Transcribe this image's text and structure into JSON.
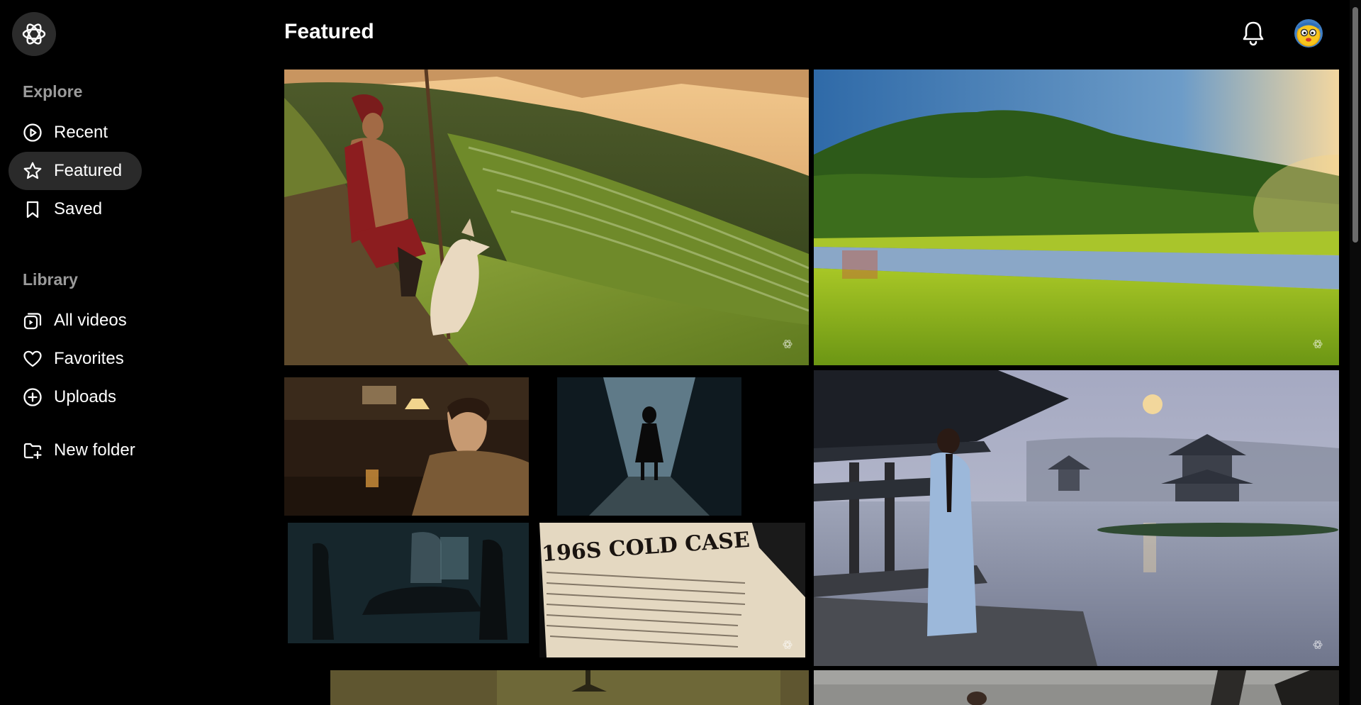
{
  "sidebar": {
    "logo_icon": "openai-logo-icon",
    "explore_title": "Explore",
    "explore_items": [
      {
        "label": "Recent",
        "icon": "play-circle-icon"
      },
      {
        "label": "Featured",
        "icon": "star-icon",
        "active": true
      },
      {
        "label": "Saved",
        "icon": "bookmark-icon"
      }
    ],
    "library_title": "Library",
    "library_items": [
      {
        "label": "All videos",
        "icon": "videos-icon"
      },
      {
        "label": "Favorites",
        "icon": "heart-icon"
      },
      {
        "label": "Uploads",
        "icon": "plus-circle-icon"
      }
    ],
    "new_folder_label": "New folder",
    "new_folder_icon": "folder-plus-icon"
  },
  "header": {
    "title": "Featured",
    "notification_icon": "bell-icon",
    "avatar_icon": "avatar"
  },
  "videos": [
    {
      "scene": "man-with-dog-on-rice-terraces"
    },
    {
      "scene": "green-valley-lake-sunrise"
    },
    {
      "scene": "noir-film-collage"
    },
    {
      "scene": "pagoda-lake-woman-moon"
    },
    {
      "scene": "interior-lamp-partial"
    },
    {
      "scene": "misty-landscape-partial"
    }
  ],
  "collage": {
    "newspaper_headline": "196S COLD CASE"
  },
  "colors": {
    "background": "#000000",
    "active_nav": "#2a2a2a",
    "muted_text": "#9b9b9b"
  }
}
